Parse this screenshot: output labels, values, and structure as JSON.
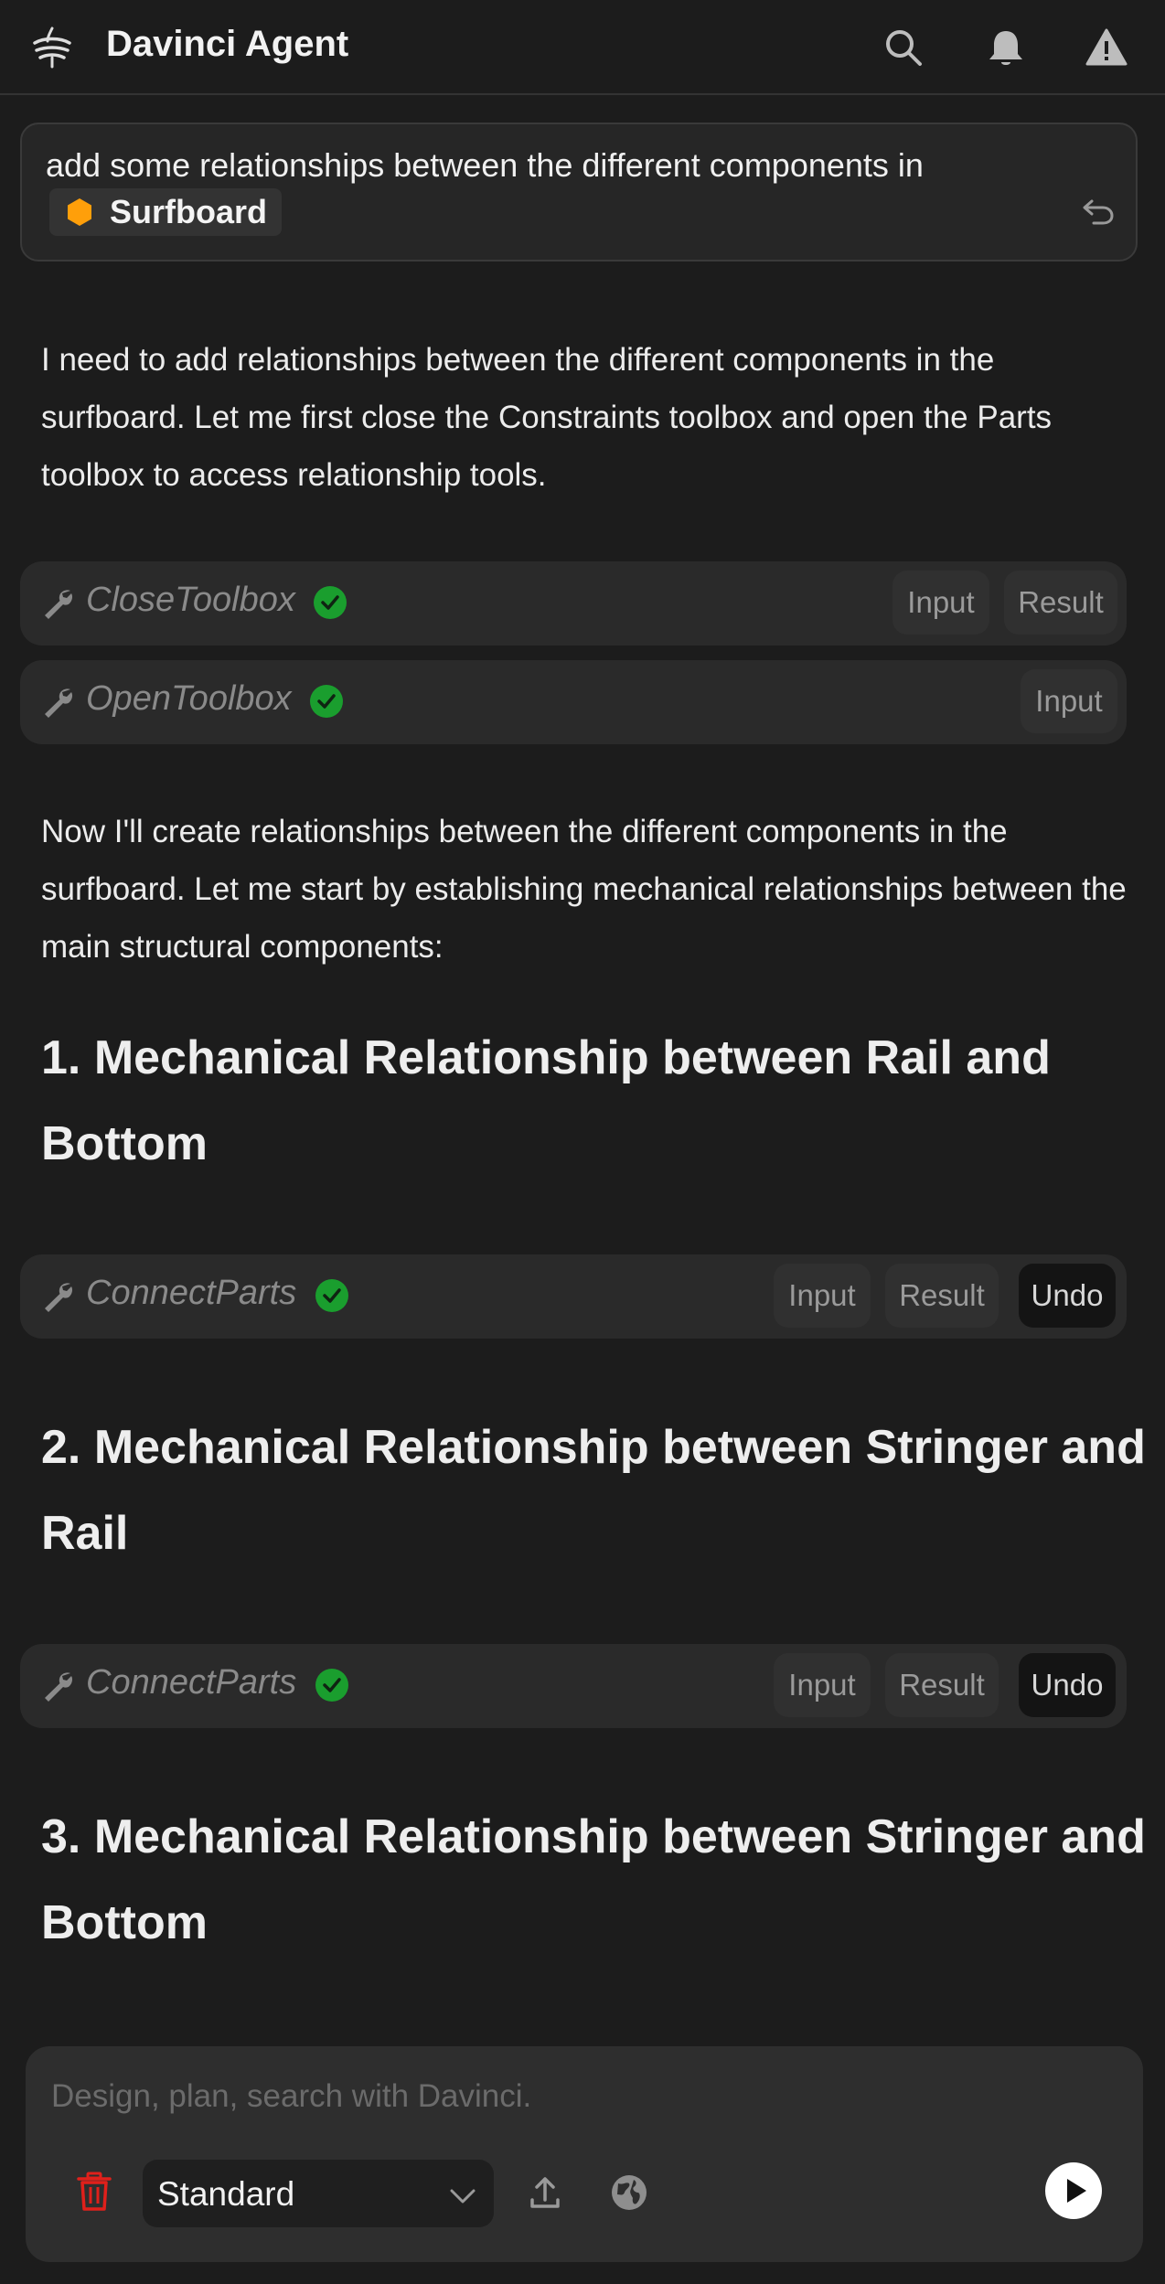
{
  "header": {
    "title": "Davinci Agent",
    "icons": [
      "logo-icon",
      "search-icon",
      "bell-icon",
      "warning-icon"
    ]
  },
  "user_message": {
    "text": "add some relationships between the different components in",
    "mention": {
      "label": "Surfboard",
      "icon": "hexagon-icon",
      "color": "#ff9f0a"
    }
  },
  "messages": {
    "para1": "I need to add relationships between the different components in the surfboard. Let me first close the Constraints toolbox and open the Parts toolbox to access relationship tools.",
    "para2": "Now I'll create relationships between the different components in the surfboard. Let me start by establishing mechanical relationships between the main structural components:",
    "heading1": "1. Mechanical Relationship between Rail and Bottom",
    "heading2": "2. Mechanical Relationship between Stringer and Rail",
    "heading3": "3. Mechanical Relationship between Stringer and Bottom"
  },
  "tools": {
    "close_toolbox": {
      "name": "CloseToolbox",
      "input": "Input",
      "result": "Result"
    },
    "open_toolbox": {
      "name": "OpenToolbox",
      "input": "Input"
    },
    "connect1": {
      "name": "ConnectParts",
      "input": "Input",
      "result": "Result",
      "undo": "Undo"
    },
    "connect2": {
      "name": "ConnectParts",
      "input": "Input",
      "result": "Result",
      "undo": "Undo"
    }
  },
  "composer": {
    "placeholder": "Design, plan, search with Davinci.",
    "mode": "Standard"
  },
  "colors": {
    "background": "#1c1c1c",
    "success": "#1a9e2e",
    "danger": "#e0201b",
    "mention_accent": "#ff9f0a"
  }
}
